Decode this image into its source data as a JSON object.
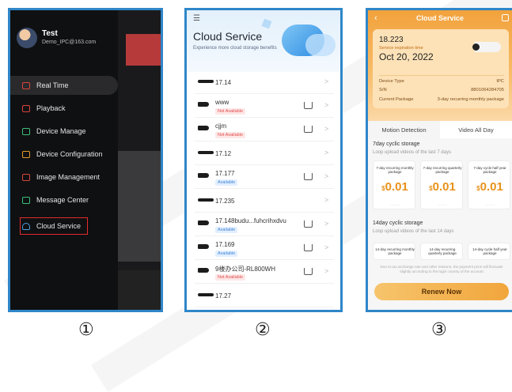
{
  "step_labels": [
    "①",
    "②",
    "③"
  ],
  "screen1": {
    "user": {
      "name": "Test",
      "email": "Demo_IPC@163.com"
    },
    "menu": [
      {
        "label": "Real Time",
        "icon": "play-icon",
        "active": true
      },
      {
        "label": "Playback",
        "icon": "film-icon",
        "active": false
      },
      {
        "label": "Device Manage",
        "icon": "camera-icon",
        "active": false
      },
      {
        "label": "Device Configuration",
        "icon": "settings-icon",
        "active": false
      },
      {
        "label": "Image Management",
        "icon": "image-icon",
        "active": false
      },
      {
        "label": "Message Center",
        "icon": "message-icon",
        "active": false
      },
      {
        "label": "Cloud Service",
        "icon": "cloud-icon",
        "active": false,
        "highlighted": true
      }
    ],
    "colors": {
      "background": "#0f1012",
      "highlight_border": "#e32b2b"
    }
  },
  "screen2": {
    "menu_icon": "☰",
    "title": "Cloud Service",
    "subtitle": "Experience more cloud storage benefits",
    "devices": [
      {
        "name": "17.14",
        "status": "",
        "type": "wide"
      },
      {
        "name": "www",
        "status": "Not Available",
        "type": "bullet",
        "cart": true
      },
      {
        "name": "cjjm",
        "status": "Not Available",
        "type": "bullet",
        "cart": true
      },
      {
        "name": "17.12",
        "status": "",
        "type": "wide"
      },
      {
        "name": "17.177",
        "status": "Available",
        "type": "bullet",
        "cart": true
      },
      {
        "name": "17.235",
        "status": "",
        "type": "wide"
      },
      {
        "name": "17.148budu...fuhcrihxdvu",
        "status": "Available",
        "type": "bullet",
        "cart": true
      },
      {
        "name": "17.169",
        "status": "Available",
        "type": "bullet",
        "cart": true
      },
      {
        "name": "9楼办公司-RL800WH",
        "status": "Not Available",
        "type": "bullet",
        "cart": true
      },
      {
        "name": "17.27",
        "status": "",
        "type": "wide"
      }
    ]
  },
  "screen3": {
    "back": "‹",
    "title": "Cloud Service",
    "days_left": "18.223",
    "expiration_label": "Service expiration time",
    "expiration_date": "Oct 20, 2022",
    "info_rows": [
      {
        "label": "Device Type",
        "value": "IPC"
      },
      {
        "label": "S/N",
        "value": "8801064284705"
      },
      {
        "label": "Current Package",
        "value": "3-day recurring monthly package"
      }
    ],
    "tabs": [
      "Motion Detection",
      "Video All Day"
    ],
    "active_tab": 0,
    "sections": [
      {
        "title": "7day cyclic storage",
        "subtitle": "Loop upload videos of the last 7 days",
        "packages": [
          {
            "name": "7-day recurring monthly package",
            "price": "0.01"
          },
          {
            "name": "7-day recurring quarterly package",
            "price": "0.01"
          },
          {
            "name": "7-day cycle half year package",
            "price": "0.01"
          }
        ]
      },
      {
        "title": "14day cyclic storage",
        "subtitle": "Loop upload videos of the last 14 days",
        "packages": [
          {
            "name": "14-day recurring monthly package"
          },
          {
            "name": "14-day recurring quarterly package"
          },
          {
            "name": "14-day cycle half year package"
          }
        ]
      }
    ],
    "note": "Due to tax,exchange rate and other reasons, the payment price will fluctuate slightly according to the login country of the account",
    "renew_label": "Renew Now",
    "colors": {
      "header": "#f2a23c",
      "price": "#e8921b",
      "renew": "#f1a63c"
    }
  }
}
